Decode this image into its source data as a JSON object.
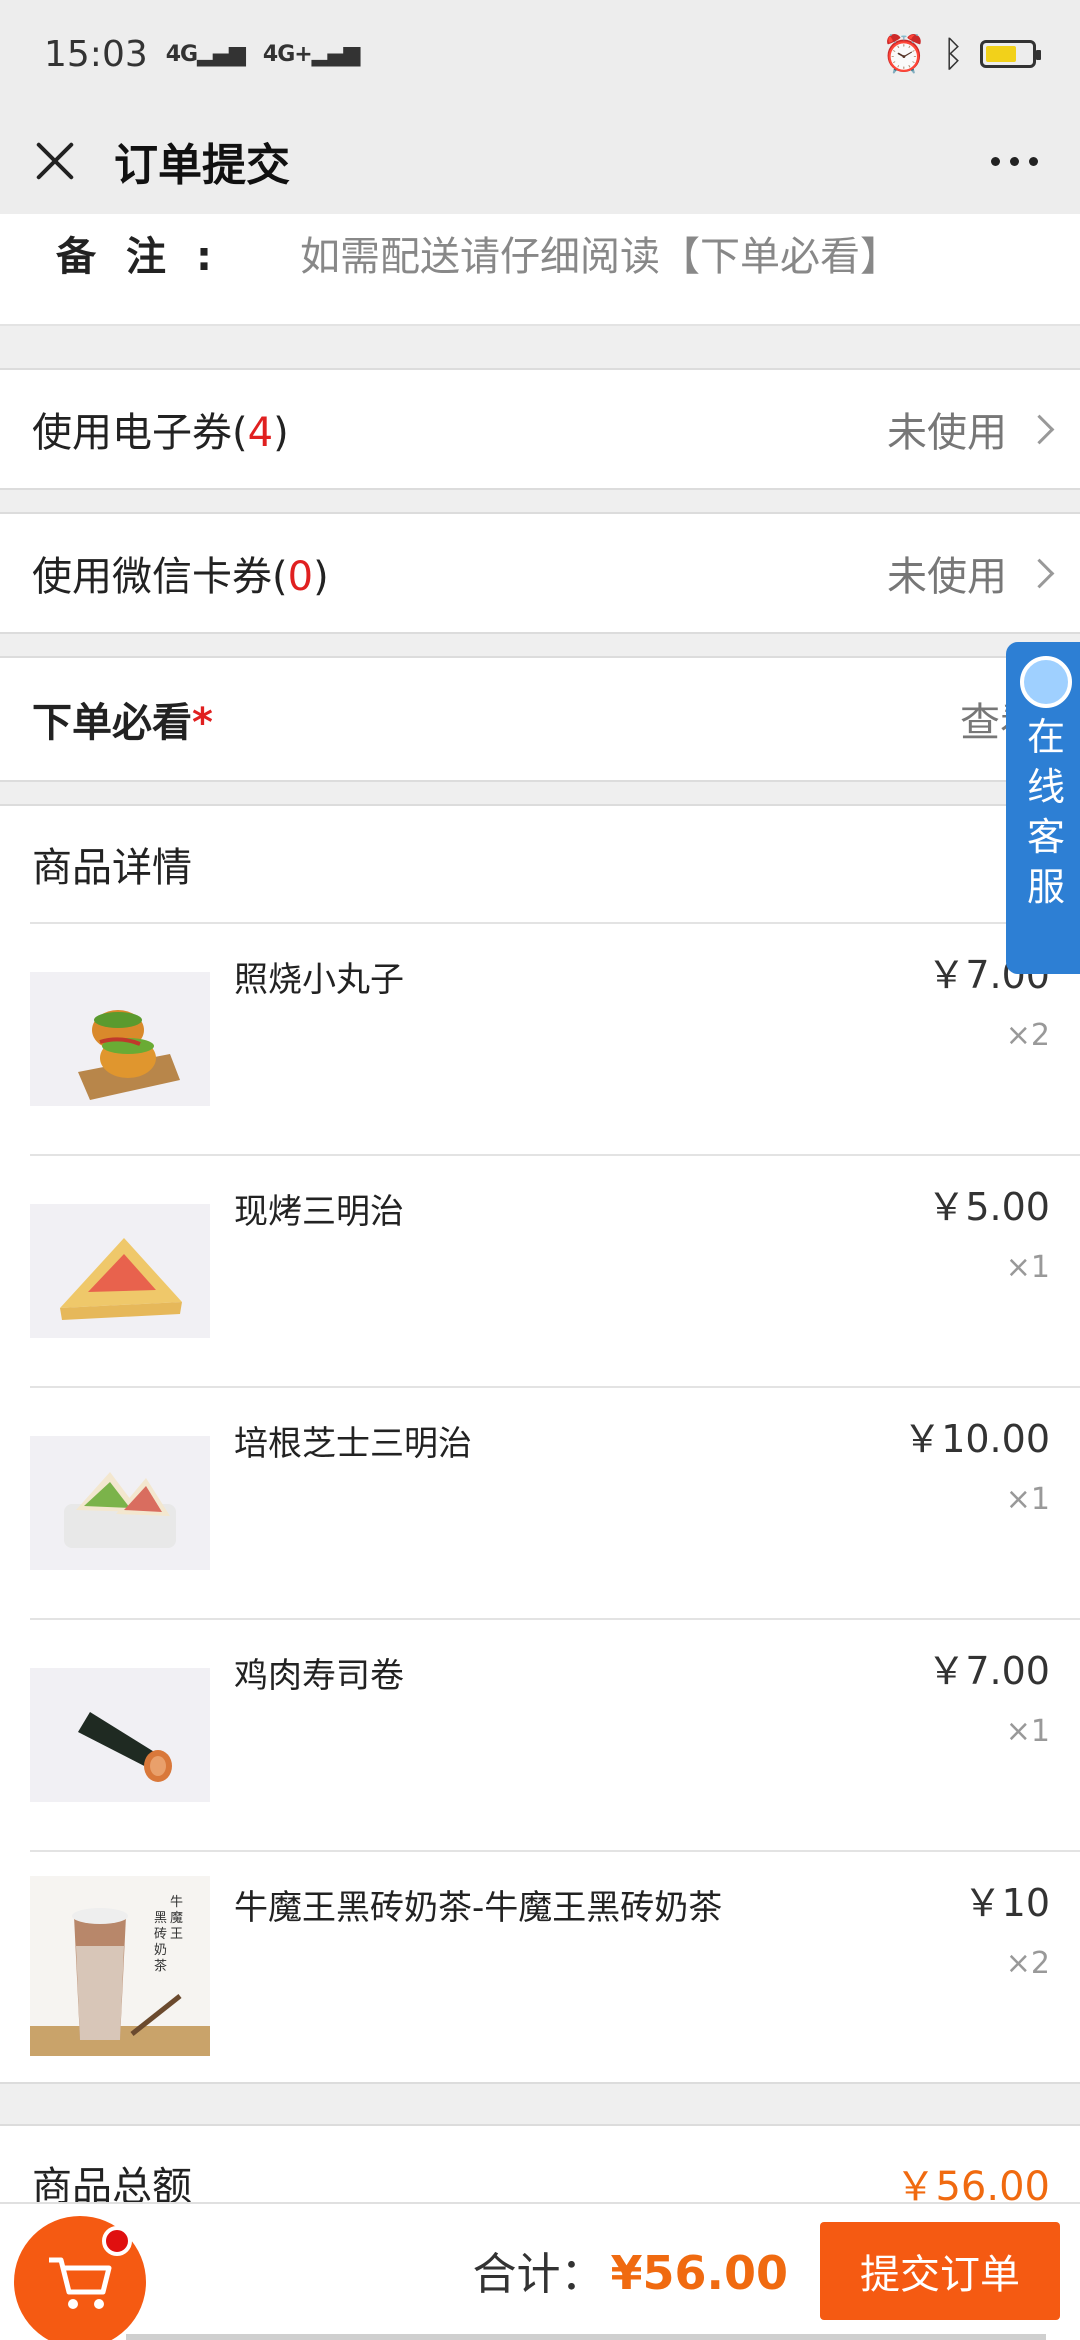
{
  "status_bar": {
    "time": "15:03",
    "signal_1": "4G",
    "signal_2": "4G+"
  },
  "header": {
    "title": "订单提交"
  },
  "remark": {
    "label": "备注:",
    "value": "如需配送请仔细阅读【下单必看】"
  },
  "coupons": [
    {
      "label": "使用电子券(",
      "count": "4",
      "suffix": ")",
      "status": "未使用"
    },
    {
      "label": "使用微信卡券(",
      "count": "0",
      "suffix": ")",
      "status": "未使用"
    }
  ],
  "must_read": {
    "label": "下单必看",
    "star": "*",
    "action": "查看"
  },
  "products": {
    "heading": "商品详情",
    "items": [
      {
        "name": "照烧小丸子",
        "price": "￥7.00",
        "qty": "×2"
      },
      {
        "name": "现烤三明治",
        "price": "￥5.00",
        "qty": "×1"
      },
      {
        "name": "培根芝士三明治",
        "price": "￥10.00",
        "qty": "×1"
      },
      {
        "name": "鸡肉寿司卷",
        "price": "￥7.00",
        "qty": "×1"
      },
      {
        "name": "牛魔王黑砖奶茶-牛魔王黑砖奶茶",
        "price": "￥10",
        "qty": "×2",
        "image_text": "牛魔王黑砖奶茶"
      }
    ]
  },
  "total": {
    "label": "商品总额",
    "value": "￥56.00"
  },
  "bottom_bar": {
    "sum_label": "合计：",
    "sum_value": "¥56.00",
    "submit_label": "提交订单"
  },
  "customer_service": {
    "label": "在线客服"
  },
  "colors": {
    "accent": "#f55a12",
    "price_orange": "#f06a10",
    "red": "#e02020",
    "service_blue": "#2d7fd4"
  }
}
